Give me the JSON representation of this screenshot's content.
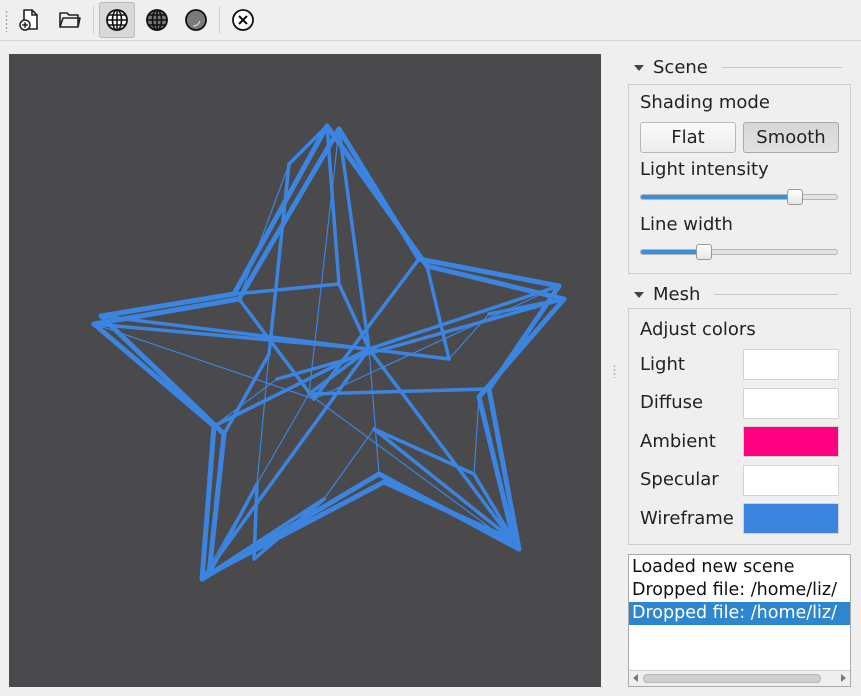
{
  "toolbar": {
    "buttons": [
      {
        "name": "new-scene",
        "icon": "new-file-icon",
        "checked": false
      },
      {
        "name": "open-file",
        "icon": "open-folder-icon",
        "checked": false
      },
      {
        "name": "wireframe-mode",
        "icon": "wireframe-globe-icon",
        "checked": true
      },
      {
        "name": "shaded-wireframe-mode",
        "icon": "shaded-globe-icon",
        "checked": false
      },
      {
        "name": "solid-mode",
        "icon": "solid-sphere-icon",
        "checked": false
      },
      {
        "name": "close",
        "icon": "close-circle-icon",
        "checked": false
      }
    ]
  },
  "scene": {
    "title": "Scene",
    "shading_label": "Shading mode",
    "flat_label": "Flat",
    "smooth_label": "Smooth",
    "selected_shading": "Smooth",
    "light_label": "Light intensity",
    "light_value": 0.8,
    "line_label": "Line width",
    "line_value": 0.3
  },
  "mesh": {
    "title": "Mesh",
    "adjust_label": "Adjust colors",
    "colors": [
      {
        "label": "Light",
        "value": "#ffffff"
      },
      {
        "label": "Diffuse",
        "value": "#ffffff"
      },
      {
        "label": "Ambient",
        "value": "#ff0080"
      },
      {
        "label": "Specular",
        "value": "#ffffff"
      },
      {
        "label": "Wireframe",
        "value": "#3b84e0"
      }
    ]
  },
  "log": {
    "lines": [
      "Loaded new scene",
      "Dropped file: /home/liz/",
      "Dropped file: /home/liz/"
    ],
    "selected_index": 2
  },
  "viewport": {
    "background": "#4a4a4c",
    "wire_color": "#3b84e0"
  }
}
